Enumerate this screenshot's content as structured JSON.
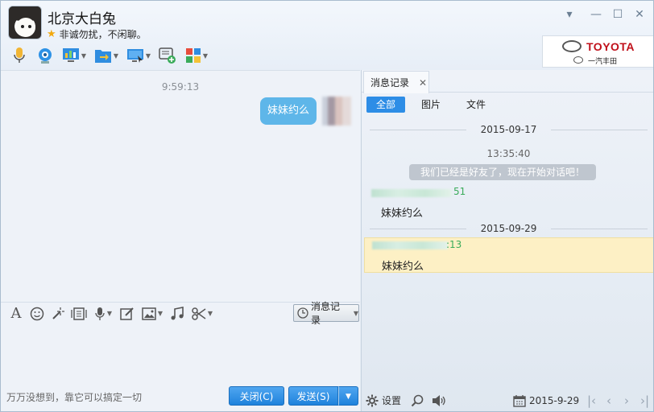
{
  "window": {
    "contact_name": "北京大白兔",
    "signature": "非诚勿扰，不闲聊。",
    "controls": [
      "minimize-dropdown",
      "minimize",
      "maximize",
      "close"
    ]
  },
  "toolbar": {
    "icons": [
      "microphone-icon",
      "video-camera-icon",
      "remote-desktop-icon",
      "file-transfer-icon",
      "screen-share-icon",
      "message-add-icon",
      "apps-icon"
    ]
  },
  "ad": {
    "brand": "TOYOTA",
    "sub": "一汽丰田"
  },
  "chat": {
    "timestamp": "9:59:13",
    "message": "妹妹约么"
  },
  "input_toolbar": {
    "message_record_label": "消息记录"
  },
  "footer": {
    "tip": "万万没想到，靠它可以搞定一切",
    "close_label": "关闭(C)",
    "send_label": "发送(S)"
  },
  "history": {
    "tab_label": "消息记录",
    "filters": [
      "全部",
      "图片",
      "文件"
    ],
    "date1": "2015-09-17",
    "time1": "13:35:40",
    "system_message": "我们已经是好友了，现在开始对话吧！",
    "sender1_time": "51",
    "msg1": "妹妹约么",
    "date2": "2015-09-29",
    "sender2_time": ":13",
    "msg2": "妹妹约么",
    "settings_label": "设置",
    "current_date": "2015-9-29"
  },
  "colors": {
    "accent": "#2d8de6",
    "bubble": "#5eb6e9",
    "highlight": "#fdf0c5",
    "sender_green": "#3aab5a"
  }
}
